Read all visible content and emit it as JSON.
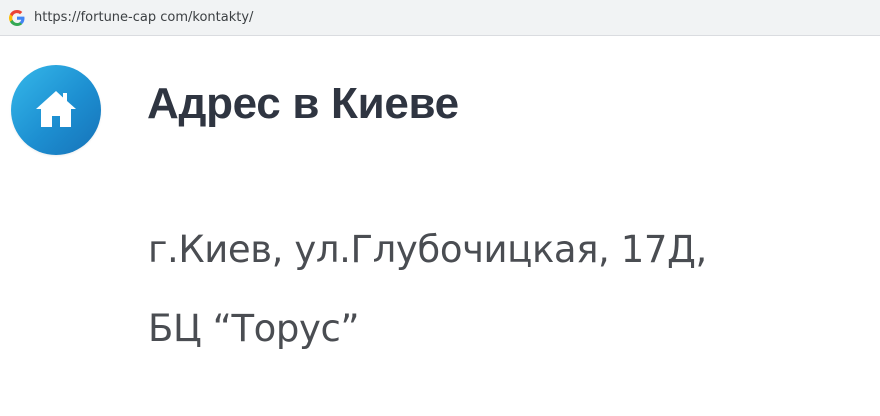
{
  "browser": {
    "url": "https://fortune-cap com/kontakty/",
    "favicon": "google-g-icon"
  },
  "section": {
    "icon": "home-icon",
    "icon_color": "#1d8fd1",
    "title": "Адрес в Киеве",
    "address_line1": "г.Киев, ул.Глубочицкая, 17Д,",
    "address_line2": "БЦ “Торус”"
  }
}
